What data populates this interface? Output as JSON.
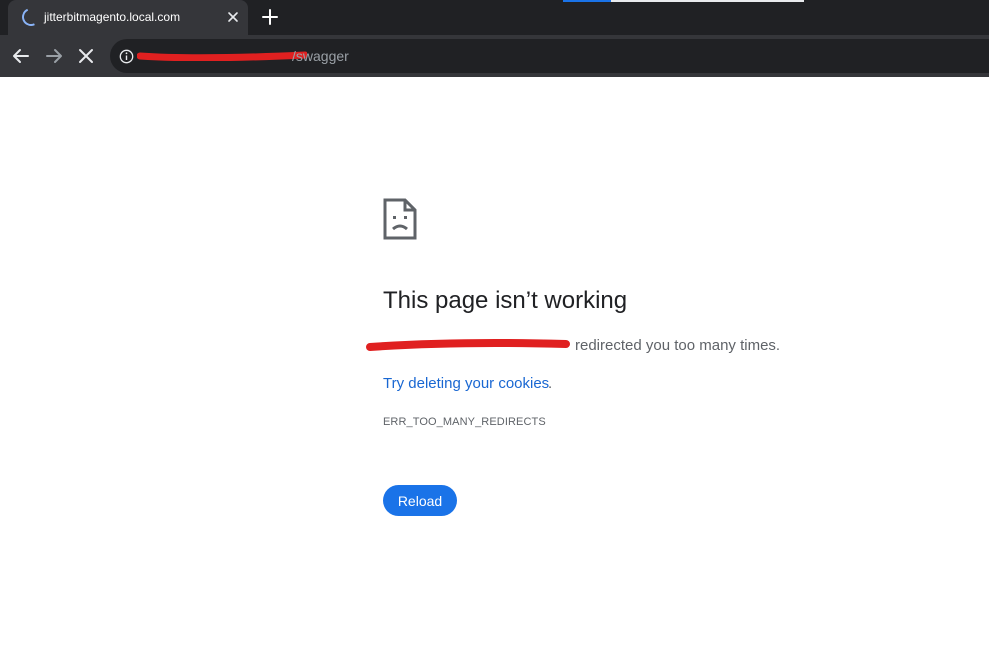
{
  "browser": {
    "tab": {
      "title": "jitterbitmagento.local.com",
      "loading_icon": "spinner-icon",
      "close_icon": "close-icon"
    },
    "new_tab_icon": "plus-icon",
    "toolbar": {
      "back_icon": "arrow-left-icon",
      "forward_icon": "arrow-right-icon",
      "stop_icon": "close-icon"
    },
    "omnibox": {
      "security_icon": "info-icon",
      "url_visible_suffix": "/swagger"
    }
  },
  "error_page": {
    "icon": "sad-page-icon",
    "heading": "This page isn’t working",
    "message_suffix": "redirected you too many times.",
    "suggestion_link": "Try deleting your cookies",
    "suggestion_suffix": ".",
    "error_code": "ERR_TOO_MANY_REDIRECTS",
    "reload_label": "Reload"
  },
  "colors": {
    "tab_strip": "#202124",
    "toolbar": "#35363a",
    "link": "#1967d2",
    "button": "#1a73e8",
    "redaction": "#e02020"
  }
}
